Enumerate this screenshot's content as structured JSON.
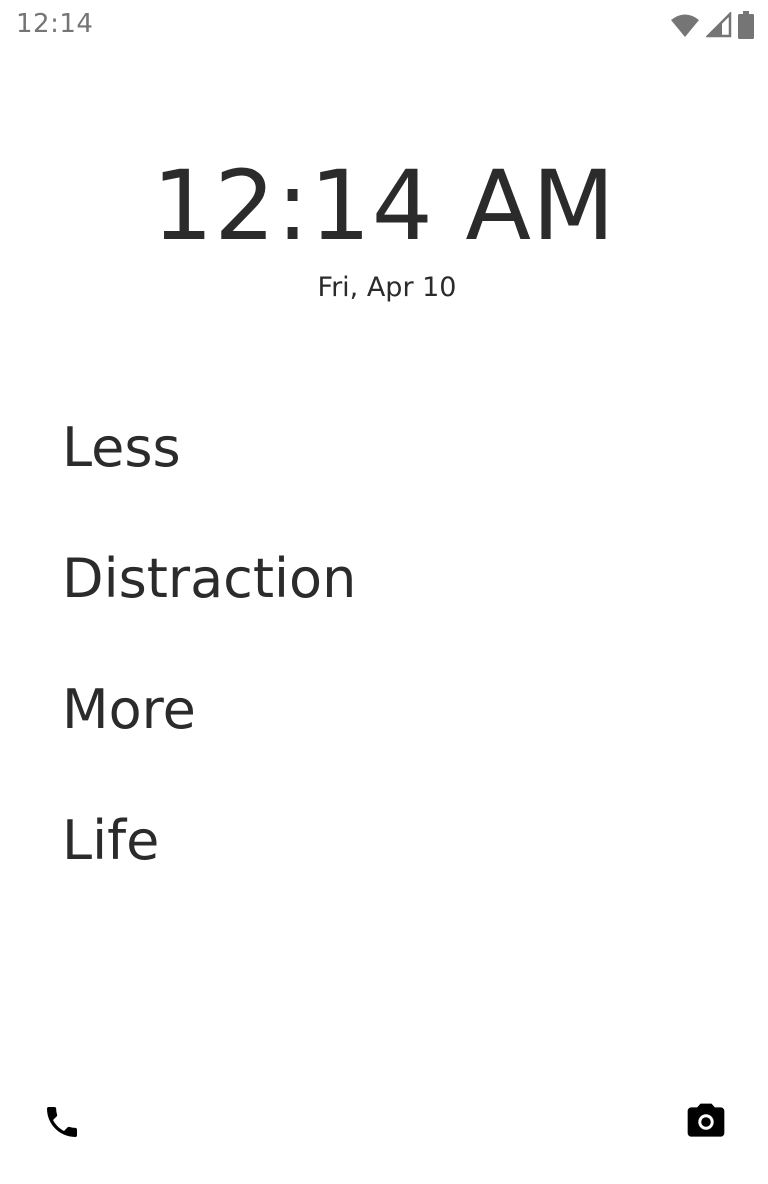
{
  "status_bar": {
    "time": "12:14",
    "icons": [
      "wifi-icon",
      "cell-signal-icon",
      "battery-icon"
    ]
  },
  "lockscreen": {
    "clock": "12:14 AM",
    "date": "Fri, Apr 10"
  },
  "slogan": {
    "lines": [
      "Less",
      "Distraction",
      "More",
      "Life"
    ]
  },
  "shortcuts": {
    "left": "phone-icon",
    "right": "camera-icon"
  },
  "colors": {
    "text": "#2b2b2b",
    "status_text": "#757575",
    "icon": "#000000",
    "background": "#ffffff"
  }
}
